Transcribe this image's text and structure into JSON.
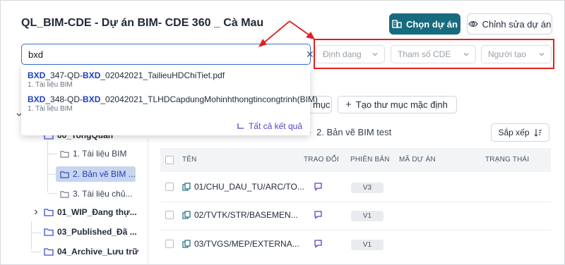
{
  "header": {
    "title": "QL_BIM-CDE - Dự án BIM- CDE 360 _ Cà Mau",
    "select_project_label": "Chọn dự án",
    "edit_project_label": "Chỉnh sửa dự án"
  },
  "search": {
    "value": "bxd",
    "suggestions": [
      {
        "prefix": "BXD",
        "middle": "_347-QD-",
        "highlight": "BXD",
        "suffix": "_02042021_TailieuHDChiTiet.pdf",
        "location": "1. Tài liệu BIM"
      },
      {
        "prefix": "BXD",
        "middle": "_348-QD-",
        "highlight": "BXD",
        "suffix": "_02042021_TLHDCapdungMohinhthongtincongtrinh(BIM)",
        "location": "1. Tài liệu BIM"
      }
    ],
    "all_results_label": "Tất cả kết quả"
  },
  "filters": {
    "format_placeholder": "Định dạng",
    "cde_param_placeholder": "Tham số CDE",
    "creator_placeholder": "Người tạo"
  },
  "folder_actions": {
    "partial_label": "mục",
    "create_default_label": "Tạo thư mục mặc định"
  },
  "tree": {
    "partial_root": "00_TongQuan",
    "children": [
      "1. Tài liệu BIM",
      "2. Bản vẽ BIM ...",
      "3. Tài liệu chủ..."
    ],
    "nodes": [
      "01_WIP_Đang thự...",
      "03_Published_Đã ...",
      "04_Archive_Lưu trữ"
    ]
  },
  "breadcrumb": {
    "current": "2. Bản vẽ BIM test"
  },
  "sort_label": "Sắp xếp",
  "table": {
    "columns": [
      "TÊN",
      "TRAO ĐỔI",
      "PHIÊN BẢN",
      "MÃ DỰ ÁN",
      "TRẠNG THÁI"
    ],
    "rows": [
      {
        "name": "01/CHU_DAU_TU/ARC/TO...",
        "version": "V3"
      },
      {
        "name": "02/TVTK/STR/BASEMEN...",
        "version": "V1"
      },
      {
        "name": "03/TVGS/MEP/EXTERNA...",
        "version": "V1"
      }
    ]
  },
  "colors": {
    "primary": "#176b7f",
    "highlight": "#1e3fbf",
    "annotation_red": "#e02020",
    "link": "#4f46c7"
  }
}
